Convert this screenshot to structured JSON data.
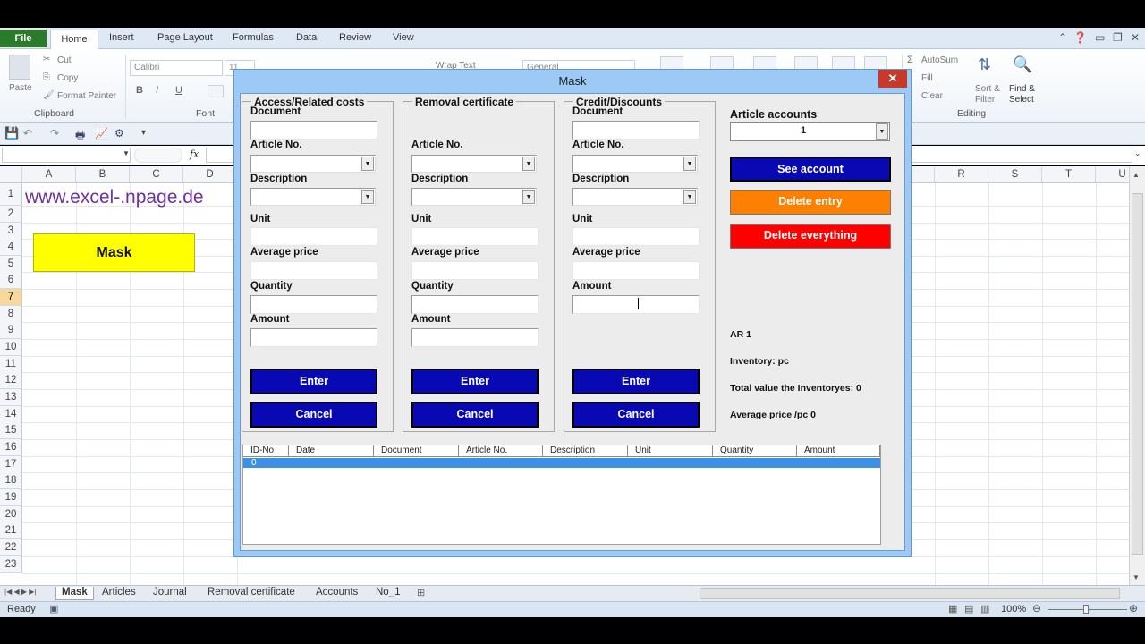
{
  "ribbon": {
    "tabs": [
      "File",
      "Home",
      "Insert",
      "Page Layout",
      "Formulas",
      "Data",
      "Review",
      "View"
    ],
    "clipboard": {
      "paste": "Paste",
      "cut": "Cut",
      "copy": "Copy",
      "format_painter": "Format Painter",
      "group": "Clipboard"
    },
    "font": {
      "name": "Calibri",
      "size": "11",
      "bold": "B",
      "italic": "I",
      "underline": "U",
      "group": "Font"
    },
    "wrap_text": "Wrap Text",
    "number_format": "General",
    "editing": {
      "autosum": "AutoSum",
      "fill": "Fill",
      "clear": "Clear",
      "sort_filter": "Sort & Filter",
      "find_select": "Find & Select",
      "group": "Editing"
    }
  },
  "formula_bar": {
    "name_box": "",
    "fx": "fx"
  },
  "grid": {
    "columns_left": [
      "A",
      "B",
      "C",
      "D"
    ],
    "columns_right": [
      "R",
      "S",
      "T",
      "U"
    ],
    "rows": [
      "1",
      "2",
      "3",
      "4",
      "5",
      "6",
      "7",
      "8",
      "9",
      "10",
      "11",
      "12",
      "13",
      "14",
      "15",
      "16",
      "17",
      "18",
      "19",
      "20",
      "21",
      "22",
      "23"
    ],
    "selected_row": "7",
    "a1_link": "www.excel-.npage.de",
    "mask_button": "Mask"
  },
  "sheets": [
    "Mask",
    "Articles",
    "Journal",
    "Removal certificate",
    "Accounts",
    "No_1"
  ],
  "status": {
    "ready": "Ready",
    "zoom": "100%"
  },
  "dialog": {
    "title": "Mask",
    "close": "✕",
    "access": {
      "caption": "Access/Related costs",
      "document": "Document",
      "article_no": "Article No.",
      "description": "Description",
      "unit": "Unit",
      "average_price": "Average price",
      "quantity": "Quantity",
      "amount": "Amount",
      "enter": "Enter",
      "cancel": "Cancel"
    },
    "removal": {
      "caption": "Removal certificate",
      "article_no": "Article No.",
      "description": "Description",
      "unit": "Unit",
      "average_price": "Average price",
      "quantity": "Quantity",
      "amount": "Amount",
      "enter": "Enter",
      "cancel": "Cancel"
    },
    "credit": {
      "caption": "Credit/Discounts",
      "document": "Document",
      "article_no": "Article No.",
      "description": "Description",
      "unit": "Unit",
      "average_price": "Average price",
      "amount": "Amount",
      "enter": "Enter",
      "cancel": "Cancel"
    },
    "accounts": {
      "label": "Article accounts",
      "selected": "1",
      "see_account": "See account",
      "delete_entry": "Delete entry",
      "delete_everything": "Delete everything",
      "ar": "AR 1",
      "inventory": "Inventory:  pc",
      "total_value": "Total value the Inventoryes: 0",
      "average_price": "Average price /pc 0"
    },
    "list": {
      "headers": [
        "ID-No",
        "Date",
        "Document",
        "Article No.",
        "Description",
        "Unit",
        "Quantity",
        "Amount"
      ],
      "rows": [
        [
          "0"
        ]
      ]
    }
  },
  "colors": {
    "see_account": "#0909b4",
    "delete_entry": "#ff8000",
    "delete_everything": "#ff0000",
    "mask_button": "#ffff00",
    "link_text": "#7030a0"
  }
}
